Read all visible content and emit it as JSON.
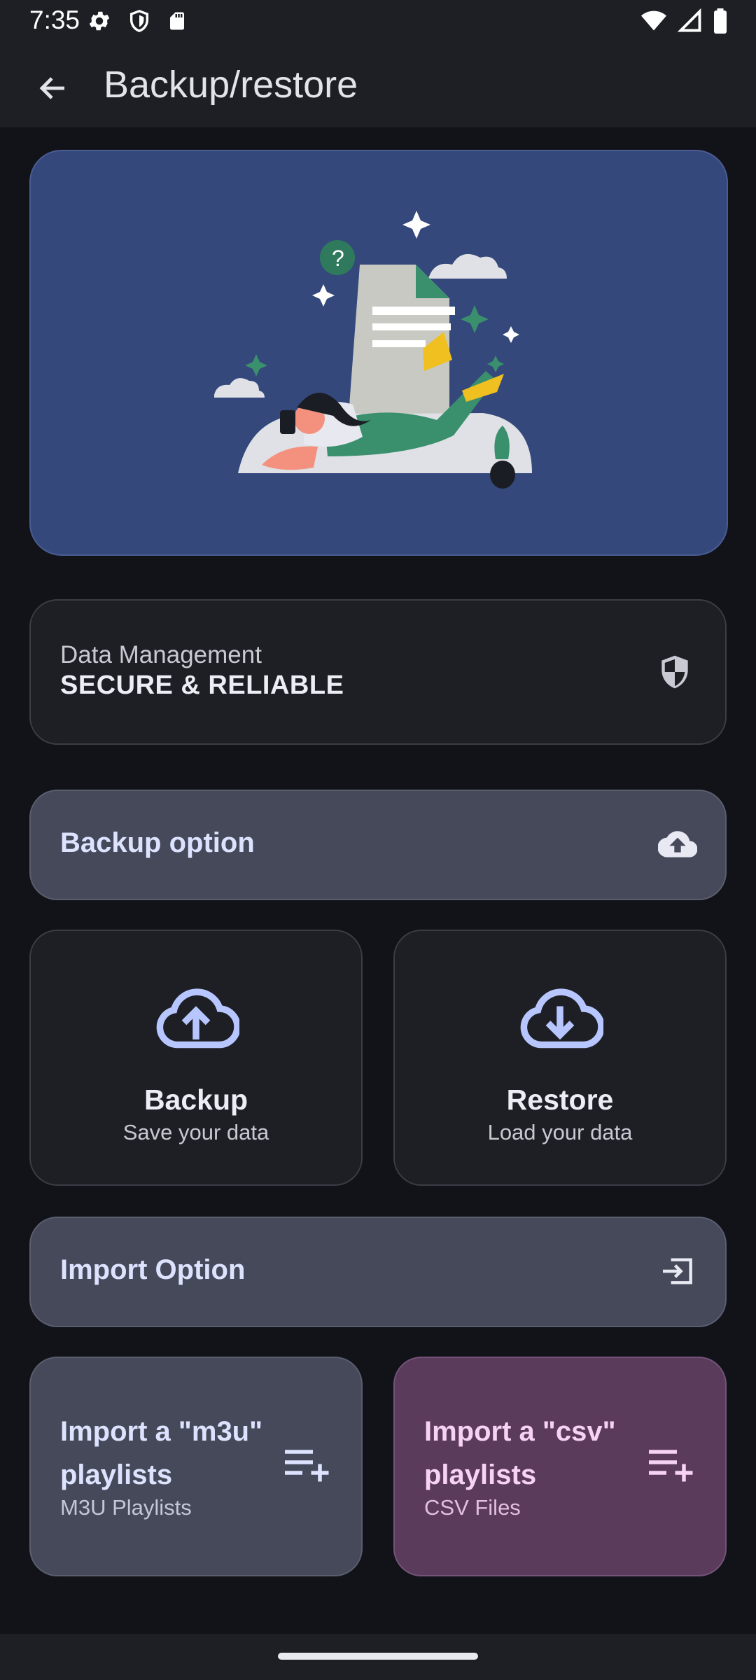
{
  "status_bar": {
    "time": "7:35",
    "left_icons": [
      "gear-icon",
      "shield-icon",
      "sd-card-icon"
    ],
    "right_icons": [
      "wifi-icon",
      "cell-signal-icon",
      "battery-icon"
    ]
  },
  "app_bar": {
    "title": "Backup/restore",
    "back_icon": "arrow-back-icon"
  },
  "data_management": {
    "label": "Data Management",
    "value": "SECURE & RELIABLE",
    "icon": "shield-icon"
  },
  "backup_section": {
    "label": "Backup option",
    "icon": "cloud-upload-icon"
  },
  "tiles": [
    {
      "title": "Backup",
      "subtitle": "Save your data",
      "icon": "cloud-upload-outline-icon"
    },
    {
      "title": "Restore",
      "subtitle": "Load your data",
      "icon": "cloud-download-outline-icon"
    }
  ],
  "import_section": {
    "label": "Import Option",
    "icon": "import-icon"
  },
  "import_cards": [
    {
      "title": "Import a \"m3u\" playlists",
      "subtitle": "M3U Playlists",
      "icon": "playlist-add-icon"
    },
    {
      "title": "Import a \"csv\" playlists",
      "subtitle": "CSV Files",
      "icon": "playlist-add-icon"
    }
  ],
  "colors": {
    "background": "#111318",
    "hero": "#34487c",
    "section_card": "#454959",
    "csv_card": "#5b3b5c",
    "accent": "#b7c6ff"
  }
}
